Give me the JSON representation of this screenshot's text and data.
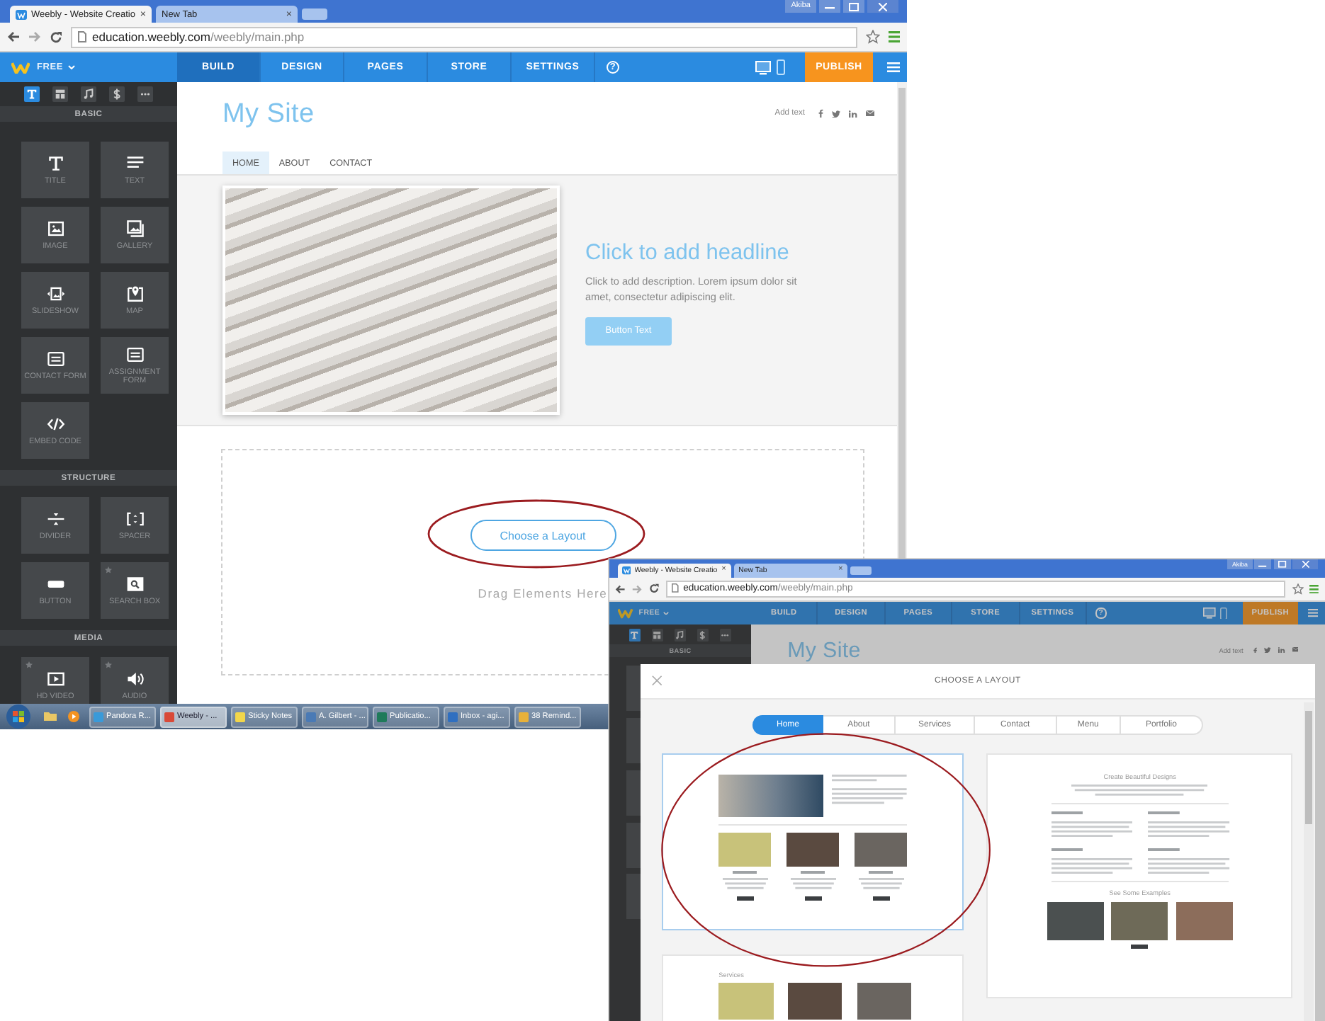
{
  "editor_screenshot": {
    "browser": {
      "tabs": [
        {
          "kind": "site",
          "title": "Weebly - Website Creatio",
          "close": "×",
          "selected": true
        },
        {
          "kind": "blank",
          "title": "New Tab",
          "close": "×",
          "selected": false
        }
      ],
      "user": "Akiba",
      "url_host": "education.weebly.com",
      "url_path": "/weebly/main.php"
    },
    "app_bar": {
      "plan": "FREE",
      "nav": [
        {
          "label": "BUILD",
          "selected": true
        },
        {
          "label": "DESIGN",
          "selected": false
        },
        {
          "label": "PAGES",
          "selected": false
        },
        {
          "label": "STORE",
          "selected": false
        },
        {
          "label": "SETTINGS",
          "selected": false
        }
      ],
      "help": "?",
      "publish": "PUBLISH"
    },
    "sidebar": {
      "tools": [
        {
          "kind": "text",
          "selected": true
        },
        {
          "kind": "layout",
          "selected": false
        },
        {
          "kind": "music",
          "selected": false
        },
        {
          "kind": "store",
          "selected": false
        },
        {
          "kind": "more",
          "selected": false
        }
      ],
      "sections": [
        {
          "title": "BASIC",
          "elements": [
            {
              "kind": "title",
              "label": "TITLE",
              "starred": false
            },
            {
              "kind": "text",
              "label": "TEXT",
              "starred": false
            },
            {
              "kind": "image",
              "label": "IMAGE",
              "starred": false
            },
            {
              "kind": "gallery",
              "label": "GALLERY",
              "starred": false
            },
            {
              "kind": "slideshow",
              "label": "SLIDESHOW",
              "starred": false
            },
            {
              "kind": "map",
              "label": "MAP",
              "starred": false
            },
            {
              "kind": "form",
              "label": "CONTACT FORM",
              "starred": false
            },
            {
              "kind": "form",
              "label": "ASSIGNMENT FORM",
              "starred": false
            },
            {
              "kind": "embed",
              "label": "EMBED CODE",
              "starred": false
            }
          ]
        },
        {
          "title": "STRUCTURE",
          "elements": [
            {
              "kind": "divider",
              "label": "DIVIDER",
              "starred": false
            },
            {
              "kind": "spacer",
              "label": "SPACER",
              "starred": false
            },
            {
              "kind": "button",
              "label": "BUTTON",
              "starred": false
            },
            {
              "kind": "search",
              "label": "SEARCH BOX",
              "starred": true
            }
          ]
        },
        {
          "title": "MEDIA",
          "elements": [
            {
              "kind": "video",
              "label": "HD VIDEO",
              "starred": true
            },
            {
              "kind": "audio",
              "label": "AUDIO",
              "starred": true
            }
          ]
        }
      ]
    },
    "site": {
      "title": "My Site",
      "add_text": "Add text",
      "nav": [
        {
          "label": "HOME",
          "selected": true
        },
        {
          "label": "ABOUT",
          "selected": false
        },
        {
          "label": "CONTACT",
          "selected": false
        }
      ],
      "headline": "Click to add headline",
      "description": "Click to add description. Lorem ipsum dolor sit amet, consectetur adipiscing elit.",
      "button": "Button Text",
      "layout_button": "Choose a Layout",
      "drop_hint": "Drag Elements Here"
    },
    "taskbar": {
      "items": [
        {
          "kind": "browser",
          "label": "Pandora R...",
          "selected": false
        },
        {
          "kind": "chrome",
          "label": "Weebly - ...",
          "selected": true
        },
        {
          "kind": "notes",
          "label": "Sticky Notes",
          "selected": false
        },
        {
          "kind": "contact",
          "label": "A. Gilbert - ...",
          "selected": false
        },
        {
          "kind": "publisher",
          "label": "Publicatio...",
          "selected": false
        },
        {
          "kind": "mail",
          "label": "Inbox - agi...",
          "selected": false
        },
        {
          "kind": "reminder",
          "label": "38 Remind...",
          "selected": false
        }
      ]
    }
  },
  "layout_screenshot": {
    "browser": {
      "tabs": [
        {
          "kind": "site",
          "title": "Weebly - Website Creatio",
          "close": "×",
          "selected": true
        },
        {
          "kind": "blank",
          "title": "New Tab",
          "close": "×",
          "selected": false
        }
      ],
      "user": "Akiba",
      "url_host": "education.weebly.com",
      "url_path": "/weebly/main.php"
    },
    "app_bar": {
      "plan": "FREE",
      "nav": [
        {
          "label": "BUILD",
          "selected": false
        },
        {
          "label": "DESIGN",
          "selected": false
        },
        {
          "label": "PAGES",
          "selected": false
        },
        {
          "label": "STORE",
          "selected": false
        },
        {
          "label": "SETTINGS",
          "selected": false
        }
      ],
      "help": "?",
      "publish": "PUBLISH"
    },
    "sidebar": {
      "tools": [
        {
          "kind": "text",
          "selected": true
        },
        {
          "kind": "layout",
          "selected": false
        },
        {
          "kind": "music",
          "selected": false
        },
        {
          "kind": "store",
          "selected": false
        },
        {
          "kind": "more",
          "selected": false
        }
      ],
      "heading": "BASIC"
    },
    "site": {
      "title": "My Site",
      "add_text": "Add text"
    },
    "dialog": {
      "title": "CHOOSE A LAYOUT",
      "tabs": [
        {
          "label": "Home",
          "selected": true
        },
        {
          "label": "About",
          "selected": false
        },
        {
          "label": "Services",
          "selected": false
        },
        {
          "label": "Contact",
          "selected": false
        },
        {
          "label": "Menu",
          "selected": false
        },
        {
          "label": "Portfolio",
          "selected": false
        }
      ],
      "cards": [
        {
          "kind": "home",
          "selected": true
        },
        {
          "kind": "designs",
          "selected": false,
          "heading": "Create Beautiful Designs",
          "subheading": "See Some Examples"
        },
        {
          "kind": "services",
          "selected": false,
          "heading": "Services"
        }
      ]
    }
  }
}
